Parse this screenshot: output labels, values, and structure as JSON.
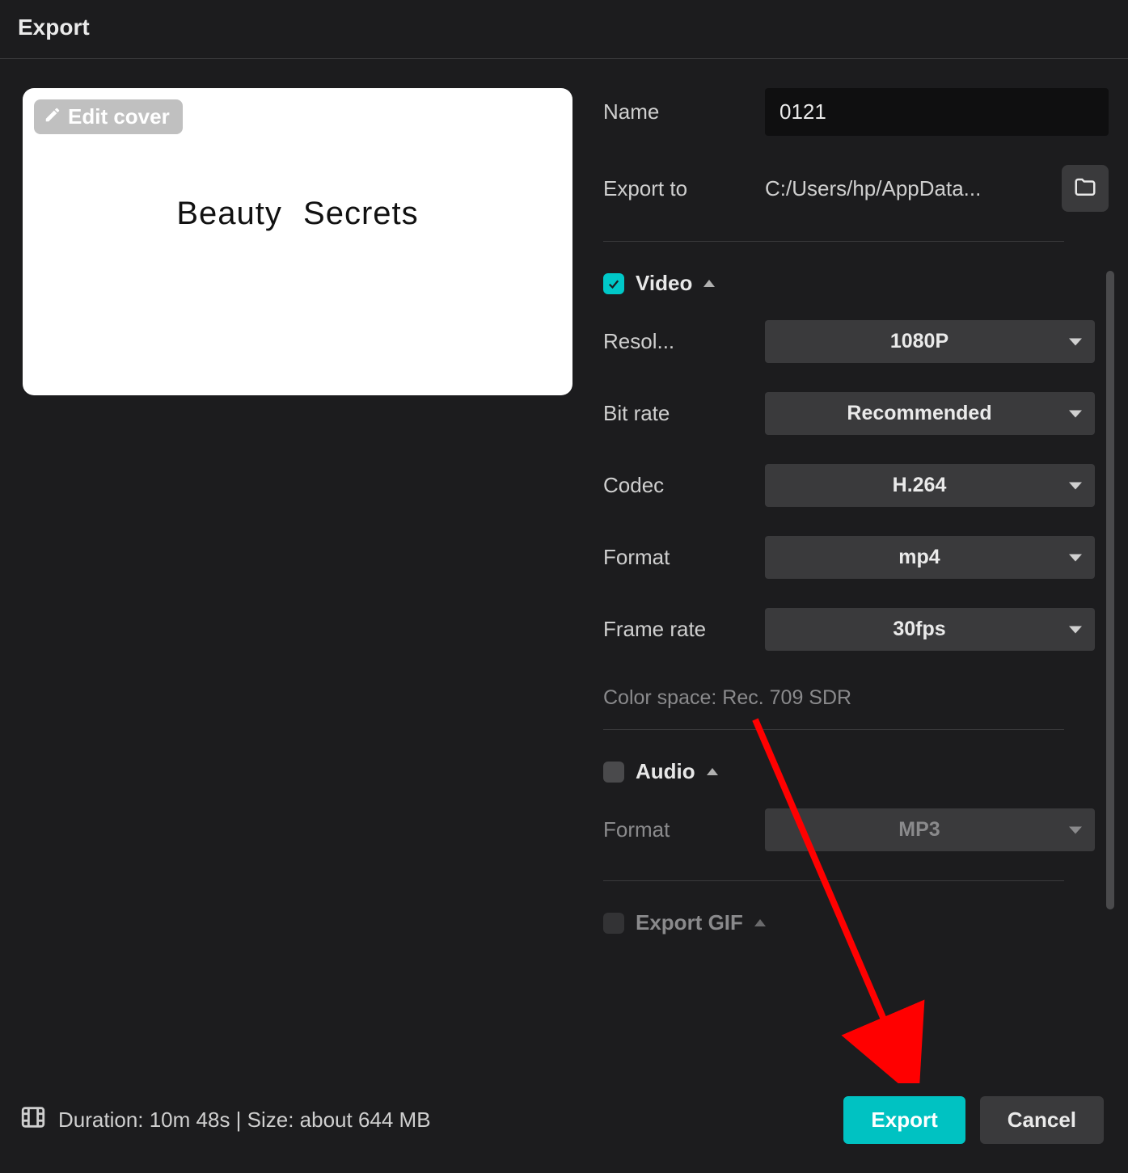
{
  "window": {
    "title": "Export"
  },
  "preview": {
    "edit_cover_label": "Edit cover",
    "thumbnail_text": "Beauty  Secrets"
  },
  "fields": {
    "name_label": "Name",
    "name_value": "0121",
    "export_to_label": "Export to",
    "export_to_value": "C:/Users/hp/AppData..."
  },
  "video": {
    "section_label": "Video",
    "checked": true,
    "resolution_label": "Resol...",
    "resolution_value": "1080P",
    "bitrate_label": "Bit rate",
    "bitrate_value": "Recommended",
    "codec_label": "Codec",
    "codec_value": "H.264",
    "format_label": "Format",
    "format_value": "mp4",
    "framerate_label": "Frame rate",
    "framerate_value": "30fps",
    "color_space_text": "Color space: Rec. 709 SDR"
  },
  "audio": {
    "section_label": "Audio",
    "checked": false,
    "format_label": "Format",
    "format_value": "MP3"
  },
  "gif": {
    "section_label": "Export GIF"
  },
  "footer": {
    "info_text": "Duration: 10m 48s | Size: about 644 MB",
    "export_label": "Export",
    "cancel_label": "Cancel"
  },
  "colors": {
    "accent": "#00c2c2",
    "annotation": "#ff0000"
  }
}
